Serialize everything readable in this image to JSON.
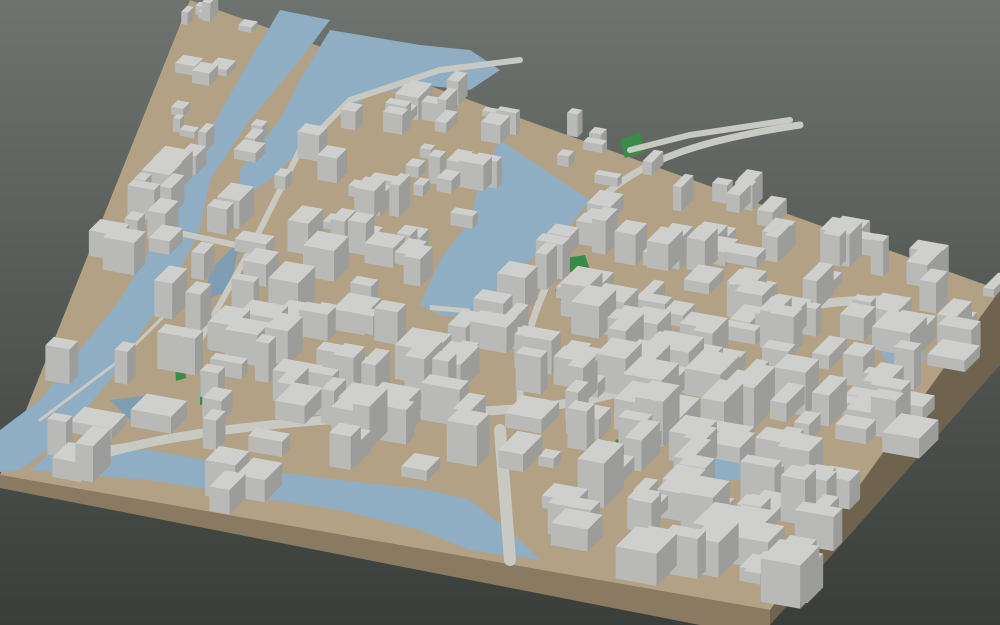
{
  "scene": {
    "colors": {
      "background_top": "#6e7370",
      "background_bottom": "#3a3e3b",
      "ground_top": "#b2a184",
      "ground_edge_front": "#8a7a62",
      "ground_edge_side": "#6f634f",
      "water": "#8faec3",
      "water_dark": "#7e9db3",
      "park": "#3a8a4a",
      "road": "#c9c9c4",
      "building_roof": "#cfcfcd",
      "building_wall_light": "#b9b9b7",
      "building_wall_dark": "#9c9c9a"
    },
    "legend": "none",
    "labels": "none"
  }
}
